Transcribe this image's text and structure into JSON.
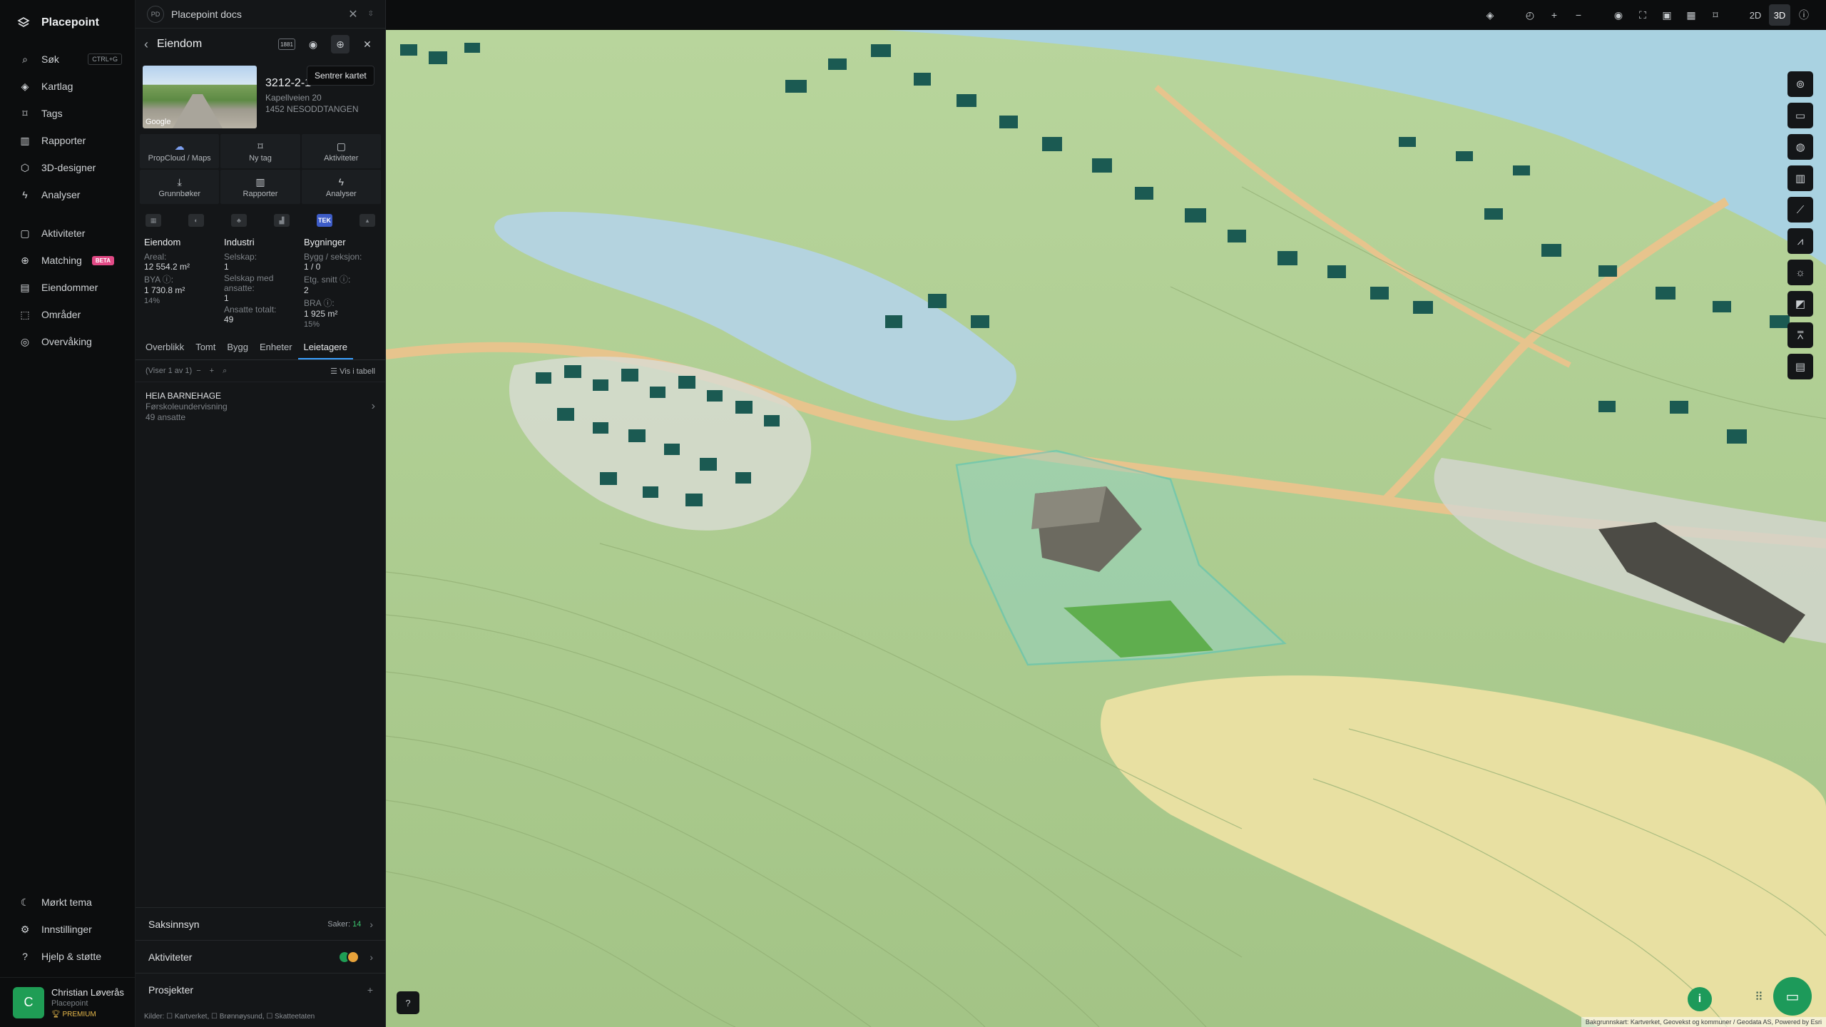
{
  "app": {
    "name": "Placepoint"
  },
  "nav": {
    "items": [
      {
        "label": "Søk",
        "kbd": "CTRL+G"
      },
      {
        "label": "Kartlag"
      },
      {
        "label": "Tags"
      },
      {
        "label": "Rapporter"
      },
      {
        "label": "3D-designer"
      },
      {
        "label": "Analyser"
      },
      {
        "label": "Aktiviteter"
      },
      {
        "label": "Matching",
        "badge": "BETA"
      },
      {
        "label": "Eiendommer"
      },
      {
        "label": "Områder"
      },
      {
        "label": "Overvåking"
      }
    ],
    "bottom": [
      {
        "label": "Mørkt tema"
      },
      {
        "label": "Innstillinger"
      },
      {
        "label": "Hjelp & støtte"
      }
    ],
    "user": {
      "initial": "C",
      "name": "Christian Løverås",
      "org": "Placepoint",
      "plan": "PREMIUM"
    }
  },
  "panel": {
    "doc_initials": "PD",
    "doc_title": "Placepoint docs",
    "header_title": "Eiendom",
    "tool_1881": "1881",
    "tooltip": "Sentrer kartet",
    "property": {
      "id": "3212-2-1",
      "address": "Kapellveien 20",
      "city": "1452 NESODDTANGEN",
      "thumb_label": "Google"
    },
    "actions": [
      {
        "label": "PropCloud / Maps"
      },
      {
        "label": "Ny tag"
      },
      {
        "label": "Aktiviteter"
      },
      {
        "label": "Grunnbøker"
      },
      {
        "label": "Rapporter"
      },
      {
        "label": "Analyser"
      }
    ],
    "source_tab_selected": "TEK",
    "stats": {
      "eiendom": {
        "title": "Eiendom",
        "areal_label": "Areal:",
        "areal_value": "12 554.2 m²",
        "bya_label": "BYA ⓘ:",
        "bya_value": "1 730.8 m²",
        "bya_pct": "14%"
      },
      "industri": {
        "title": "Industri",
        "selskap_label": "Selskap:",
        "selskap_value": "1",
        "ansatte_label": "Selskap med ansatte:",
        "ansatte_value": "1",
        "total_label": "Ansatte totalt:",
        "total_value": "49"
      },
      "bygninger": {
        "title": "Bygninger",
        "bygg_label": "Bygg / seksjon:",
        "bygg_value": "1 / 0",
        "etg_label": "Etg. snitt ⓘ:",
        "etg_value": "2",
        "bra_label": "BRA ⓘ:",
        "bra_value": "1 925 m²",
        "bra_pct": "15%"
      }
    },
    "subtabs": [
      "Overblikk",
      "Tomt",
      "Bygg",
      "Enheter",
      "Leietagere"
    ],
    "listbar": {
      "count": "(Viser 1 av 1)",
      "view_table": "Vis i tabell"
    },
    "tenants": [
      {
        "name": "HEIA BARNEHAGE",
        "type": "Førskoleundervisning",
        "employees": "49 ansatte"
      }
    ],
    "sections": [
      {
        "label": "Saksinnsyn",
        "meta_label": "Saker:",
        "meta_value": "14"
      },
      {
        "label": "Aktiviteter"
      },
      {
        "label": "Prosjekter"
      }
    ],
    "sources": "Kilder: ☐ Kartverket, ☐ Brønnøysund, ☐ Skatteetaten"
  },
  "topbar": {
    "mode_2d": "2D",
    "mode_3d": "3D",
    "active_mode": "3D"
  },
  "map": {
    "attribution": "Bakgrunnskart: Kartverket, Geovekst og kommuner / Geodata AS, Powered by Esri",
    "colors": {
      "terrain": "#a8c98a",
      "lake": "#b4d3df",
      "sea": "#a9d2e1",
      "buildings": "#1b5a52",
      "highlight": "#39c3c8",
      "yellow": "#e8e0a2"
    }
  }
}
